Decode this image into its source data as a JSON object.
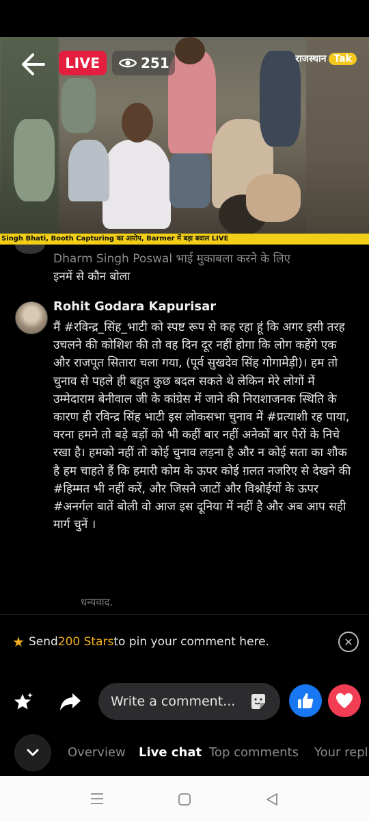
{
  "video": {
    "live_label": "LIVE",
    "viewer_count": "251",
    "channel_name": "राजस्थान",
    "channel_tag": "Tak",
    "ticker": "Singh Bhati, Booth Capturing का आरोप, Barmer में बड़ा बवाल LIVE"
  },
  "chat": {
    "previous": {
      "line1": "Dharm Singh Poswal भाई मुकाबला करने के लिए",
      "line2": "इनमें से कौन बोला"
    },
    "comment": {
      "author": "Rohit Godara Kapurisar",
      "text": "मैं #रविन्द्र_सिंह_भाटी को स्पष्ट रूप से कह रहा हूं कि अगर इसी तरह उचलने की कोशिश की तो वह दिन दूर नहीं होगा कि लोग कहेंगे एक और राजपूत सितारा चला गया, (पूर्व सुखदेव सिंह गोगामेड़ी)। हम तो चुनाव से पहले ही बहुत कुछ बदल सकते थे लेकिन मेरे लोगों में उम्मेदाराम बेनीवाल जी के कांग्रेस में जाने की निराशाजनक स्थिति के कारण ही रविन्द्र सिंह भाटी इस लोकसभा चुनाव में #प्रत्याशी रह पाया, वरना हमने तो बड़े बड़ों को भी कहीं बार नहीं अनेकों बार पैरों के निचे रखा है। हमको नहीं तो कोई चुनाव लड़ना है और न कोई सता का शौक है हम चाहते हैं कि हमारी कोम के ऊपर कोई ग़लत नजरिए से देखने की #हिम्मत भी नहीं करें, और जिसने जाटों और विश्नोईयों के ऊपर #अनर्गल बातें बोली वो आज इस दूनिया में नहीं है और अब आप सही मार्ग चुनें ।"
    },
    "next_partial": "धन्यवाद."
  },
  "promo": {
    "prefix": "Send ",
    "stars": "200 Stars",
    "suffix": " to pin your comment here."
  },
  "composer": {
    "placeholder": "Write a comment..."
  },
  "tabs": [
    "Overview",
    "Live chat",
    "Top comments",
    "Your repl"
  ],
  "colors": {
    "live_red": "#e41e3f",
    "ticker_yellow": "#f2cf16",
    "stars_accent": "#f3b020",
    "like_blue": "#1877f2",
    "love_red": "#f23d55"
  },
  "icons": [
    "back-arrow-icon",
    "eye-icon",
    "stars-icon",
    "close-icon",
    "share-icon",
    "sticker-icon",
    "like-icon",
    "love-icon",
    "chevron-down-icon",
    "recents-icon",
    "home-icon",
    "back-icon"
  ]
}
